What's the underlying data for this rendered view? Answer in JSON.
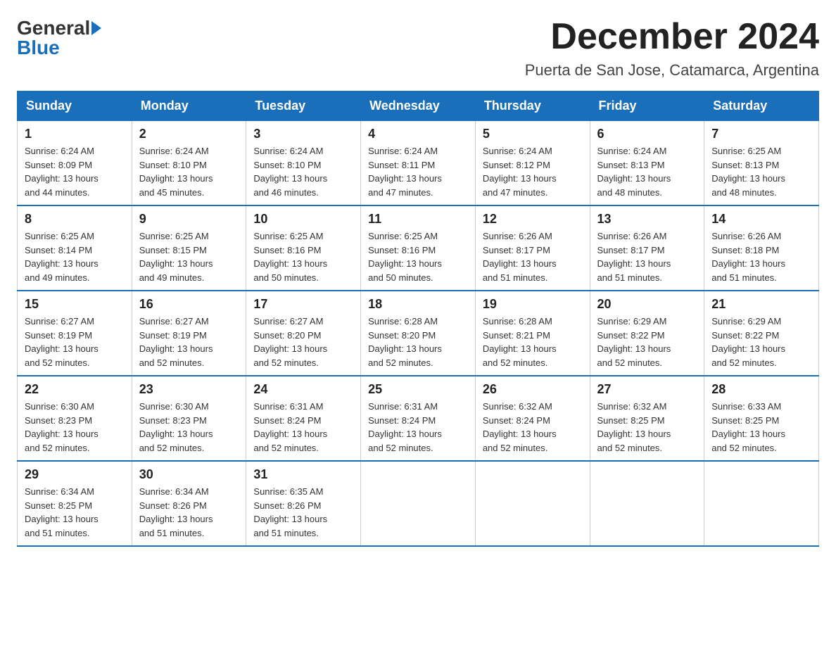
{
  "header": {
    "logo_general": "General",
    "logo_blue": "Blue",
    "month_title": "December 2024",
    "location": "Puerta de San Jose, Catamarca, Argentina"
  },
  "days_of_week": [
    "Sunday",
    "Monday",
    "Tuesday",
    "Wednesday",
    "Thursday",
    "Friday",
    "Saturday"
  ],
  "weeks": [
    [
      {
        "day": "1",
        "sunrise": "6:24 AM",
        "sunset": "8:09 PM",
        "daylight": "13 hours and 44 minutes."
      },
      {
        "day": "2",
        "sunrise": "6:24 AM",
        "sunset": "8:10 PM",
        "daylight": "13 hours and 45 minutes."
      },
      {
        "day": "3",
        "sunrise": "6:24 AM",
        "sunset": "8:10 PM",
        "daylight": "13 hours and 46 minutes."
      },
      {
        "day": "4",
        "sunrise": "6:24 AM",
        "sunset": "8:11 PM",
        "daylight": "13 hours and 47 minutes."
      },
      {
        "day": "5",
        "sunrise": "6:24 AM",
        "sunset": "8:12 PM",
        "daylight": "13 hours and 47 minutes."
      },
      {
        "day": "6",
        "sunrise": "6:24 AM",
        "sunset": "8:13 PM",
        "daylight": "13 hours and 48 minutes."
      },
      {
        "day": "7",
        "sunrise": "6:25 AM",
        "sunset": "8:13 PM",
        "daylight": "13 hours and 48 minutes."
      }
    ],
    [
      {
        "day": "8",
        "sunrise": "6:25 AM",
        "sunset": "8:14 PM",
        "daylight": "13 hours and 49 minutes."
      },
      {
        "day": "9",
        "sunrise": "6:25 AM",
        "sunset": "8:15 PM",
        "daylight": "13 hours and 49 minutes."
      },
      {
        "day": "10",
        "sunrise": "6:25 AM",
        "sunset": "8:16 PM",
        "daylight": "13 hours and 50 minutes."
      },
      {
        "day": "11",
        "sunrise": "6:25 AM",
        "sunset": "8:16 PM",
        "daylight": "13 hours and 50 minutes."
      },
      {
        "day": "12",
        "sunrise": "6:26 AM",
        "sunset": "8:17 PM",
        "daylight": "13 hours and 51 minutes."
      },
      {
        "day": "13",
        "sunrise": "6:26 AM",
        "sunset": "8:17 PM",
        "daylight": "13 hours and 51 minutes."
      },
      {
        "day": "14",
        "sunrise": "6:26 AM",
        "sunset": "8:18 PM",
        "daylight": "13 hours and 51 minutes."
      }
    ],
    [
      {
        "day": "15",
        "sunrise": "6:27 AM",
        "sunset": "8:19 PM",
        "daylight": "13 hours and 52 minutes."
      },
      {
        "day": "16",
        "sunrise": "6:27 AM",
        "sunset": "8:19 PM",
        "daylight": "13 hours and 52 minutes."
      },
      {
        "day": "17",
        "sunrise": "6:27 AM",
        "sunset": "8:20 PM",
        "daylight": "13 hours and 52 minutes."
      },
      {
        "day": "18",
        "sunrise": "6:28 AM",
        "sunset": "8:20 PM",
        "daylight": "13 hours and 52 minutes."
      },
      {
        "day": "19",
        "sunrise": "6:28 AM",
        "sunset": "8:21 PM",
        "daylight": "13 hours and 52 minutes."
      },
      {
        "day": "20",
        "sunrise": "6:29 AM",
        "sunset": "8:22 PM",
        "daylight": "13 hours and 52 minutes."
      },
      {
        "day": "21",
        "sunrise": "6:29 AM",
        "sunset": "8:22 PM",
        "daylight": "13 hours and 52 minutes."
      }
    ],
    [
      {
        "day": "22",
        "sunrise": "6:30 AM",
        "sunset": "8:23 PM",
        "daylight": "13 hours and 52 minutes."
      },
      {
        "day": "23",
        "sunrise": "6:30 AM",
        "sunset": "8:23 PM",
        "daylight": "13 hours and 52 minutes."
      },
      {
        "day": "24",
        "sunrise": "6:31 AM",
        "sunset": "8:24 PM",
        "daylight": "13 hours and 52 minutes."
      },
      {
        "day": "25",
        "sunrise": "6:31 AM",
        "sunset": "8:24 PM",
        "daylight": "13 hours and 52 minutes."
      },
      {
        "day": "26",
        "sunrise": "6:32 AM",
        "sunset": "8:24 PM",
        "daylight": "13 hours and 52 minutes."
      },
      {
        "day": "27",
        "sunrise": "6:32 AM",
        "sunset": "8:25 PM",
        "daylight": "13 hours and 52 minutes."
      },
      {
        "day": "28",
        "sunrise": "6:33 AM",
        "sunset": "8:25 PM",
        "daylight": "13 hours and 52 minutes."
      }
    ],
    [
      {
        "day": "29",
        "sunrise": "6:34 AM",
        "sunset": "8:25 PM",
        "daylight": "13 hours and 51 minutes."
      },
      {
        "day": "30",
        "sunrise": "6:34 AM",
        "sunset": "8:26 PM",
        "daylight": "13 hours and 51 minutes."
      },
      {
        "day": "31",
        "sunrise": "6:35 AM",
        "sunset": "8:26 PM",
        "daylight": "13 hours and 51 minutes."
      },
      null,
      null,
      null,
      null
    ]
  ],
  "labels": {
    "sunrise_prefix": "Sunrise: ",
    "sunset_prefix": "Sunset: ",
    "daylight_prefix": "Daylight: "
  }
}
